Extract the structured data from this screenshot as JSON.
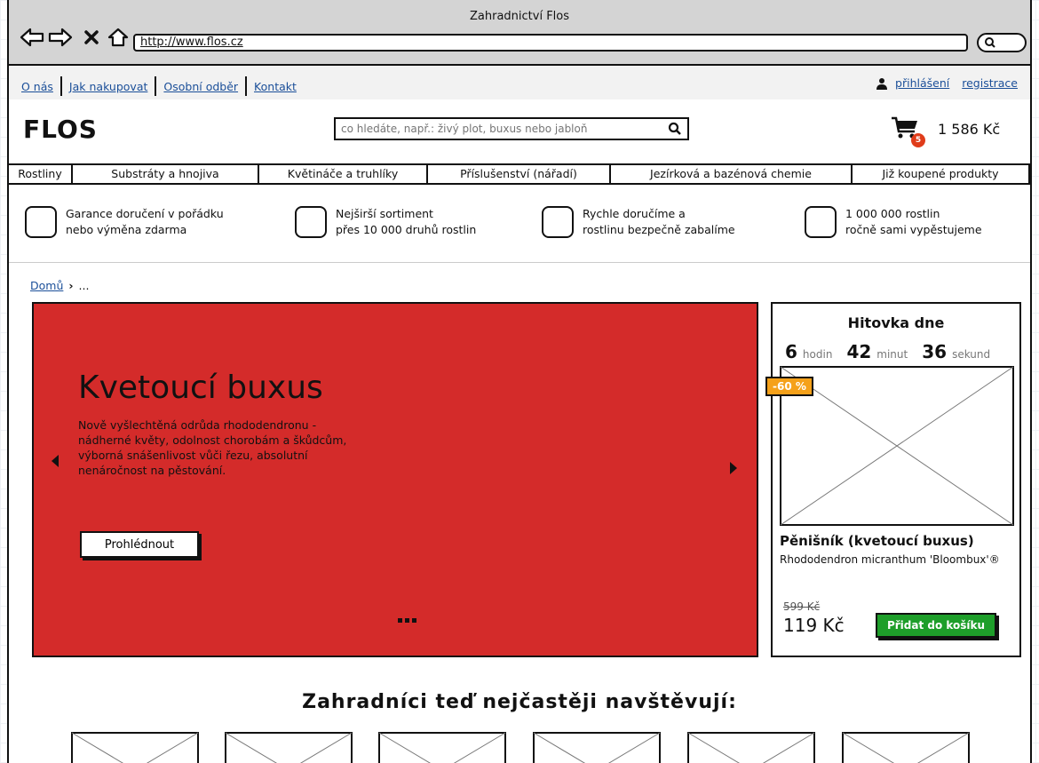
{
  "browser": {
    "title": "Zahradnictví Flos",
    "url": "http://www.flos.cz"
  },
  "toplinks": {
    "items": [
      "O nás",
      "Jak nakupovat",
      "Osobní odběr",
      "Kontakt"
    ],
    "login": "přihlášení",
    "register": "registrace"
  },
  "header": {
    "logo": "FLOS",
    "search_placeholder": "co hledáte, např.: živý plot, buxus nebo jabloň",
    "cart_count": "5",
    "cart_total": "1 586 Kč"
  },
  "categories": [
    "Rostliny",
    "Substráty a hnojiva",
    "Květináče a truhlíky",
    "Příslušenství (nářadí)",
    "Jezírková a bazénová chemie",
    "Již koupené produkty"
  ],
  "benefits": [
    {
      "line1": "Garance doručení v pořádku",
      "line2": "nebo výměna zdarma"
    },
    {
      "line1": "Nejširší sortiment",
      "line2": "přes 10 000 druhů rostlin"
    },
    {
      "line1": "Rychle doručíme a",
      "line2": "rostlinu bezpečně zabalíme"
    },
    {
      "line1": "1 000 000 rostlin",
      "line2": "ročně sami vypěstujeme"
    }
  ],
  "breadcrumb": {
    "home": "Domů",
    "rest": "..."
  },
  "hero": {
    "title": "Kvetoucí buxus",
    "description": "Nově vyšlechtěná odrůda rhododendronu - nádherné květy, odolnost chorobám a škůdcům, výborná snášenlivost vůči řezu, absolutní nenáročnost na pěstování.",
    "button": "Prohlédnout",
    "color": "#d42b2a"
  },
  "deal": {
    "title": "Hitovka dne",
    "hours": "6",
    "hours_label": "hodin",
    "minutes": "42",
    "minutes_label": "minut",
    "seconds": "36",
    "seconds_label": "sekund",
    "discount": "-60 %",
    "product_name": "Pěnišník (kvetoucí buxus)",
    "product_sub": "Rhododendron micranthum 'Bloombux'®",
    "old_price": "599 Kč",
    "new_price": "119 Kč",
    "add_button": "Přidat do košíku"
  },
  "section": {
    "title": "Zahradníci teď nejčastěji navštěvují:"
  }
}
